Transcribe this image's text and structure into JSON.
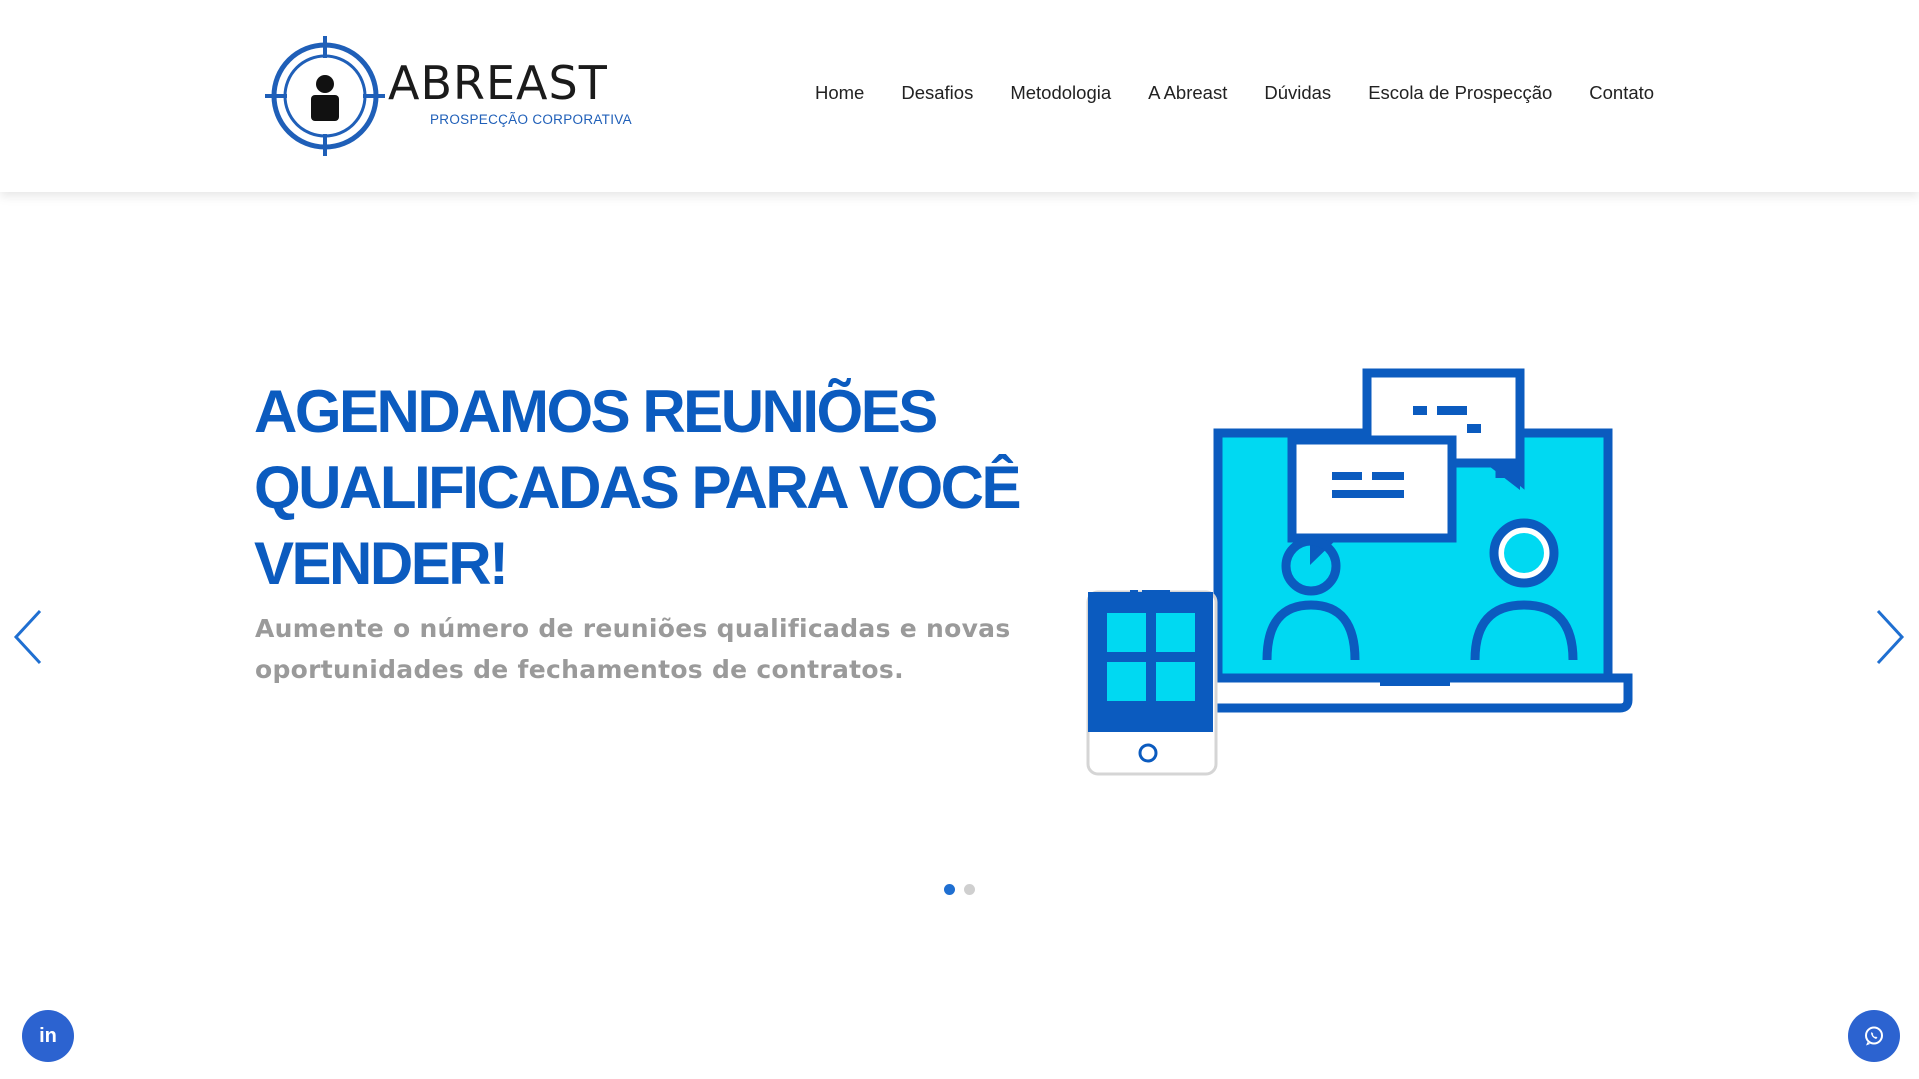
{
  "header": {
    "logo": {
      "name": "ABREAST",
      "tagline": "PROSPECÇÃO CORPORATIVA",
      "icon": "target-person-icon"
    },
    "nav": [
      {
        "label": "Home"
      },
      {
        "label": "Desafios"
      },
      {
        "label": "Metodologia"
      },
      {
        "label": "A Abreast"
      },
      {
        "label": "Dúvidas"
      },
      {
        "label": "Escola de Prospecção"
      },
      {
        "label": "Contato"
      }
    ]
  },
  "hero": {
    "headline_lines": [
      "AGENDAMOS REUNIÕES",
      "QUALIFICADAS PARA VOCÊ",
      "VENDER!"
    ],
    "subtext": "Aumente o número de reuniões qualificadas e novas oportunidades de fechamentos de contratos.",
    "illustration": "laptop-video-meeting-icon",
    "slides_total": 2,
    "active_slide": 1
  },
  "controls": {
    "prev_icon": "chevron-left-icon",
    "next_icon": "chevron-right-icon"
  },
  "floating": {
    "linkedin_label": "in",
    "linkedin_icon": "linkedin-icon",
    "whatsapp_icon": "whatsapp-icon"
  },
  "colors": {
    "brand_blue": "#0b5bbf",
    "accent_cyan": "#00d4f0",
    "button_blue": "#2c63d0",
    "subtext_gray": "#9a9a9a"
  }
}
